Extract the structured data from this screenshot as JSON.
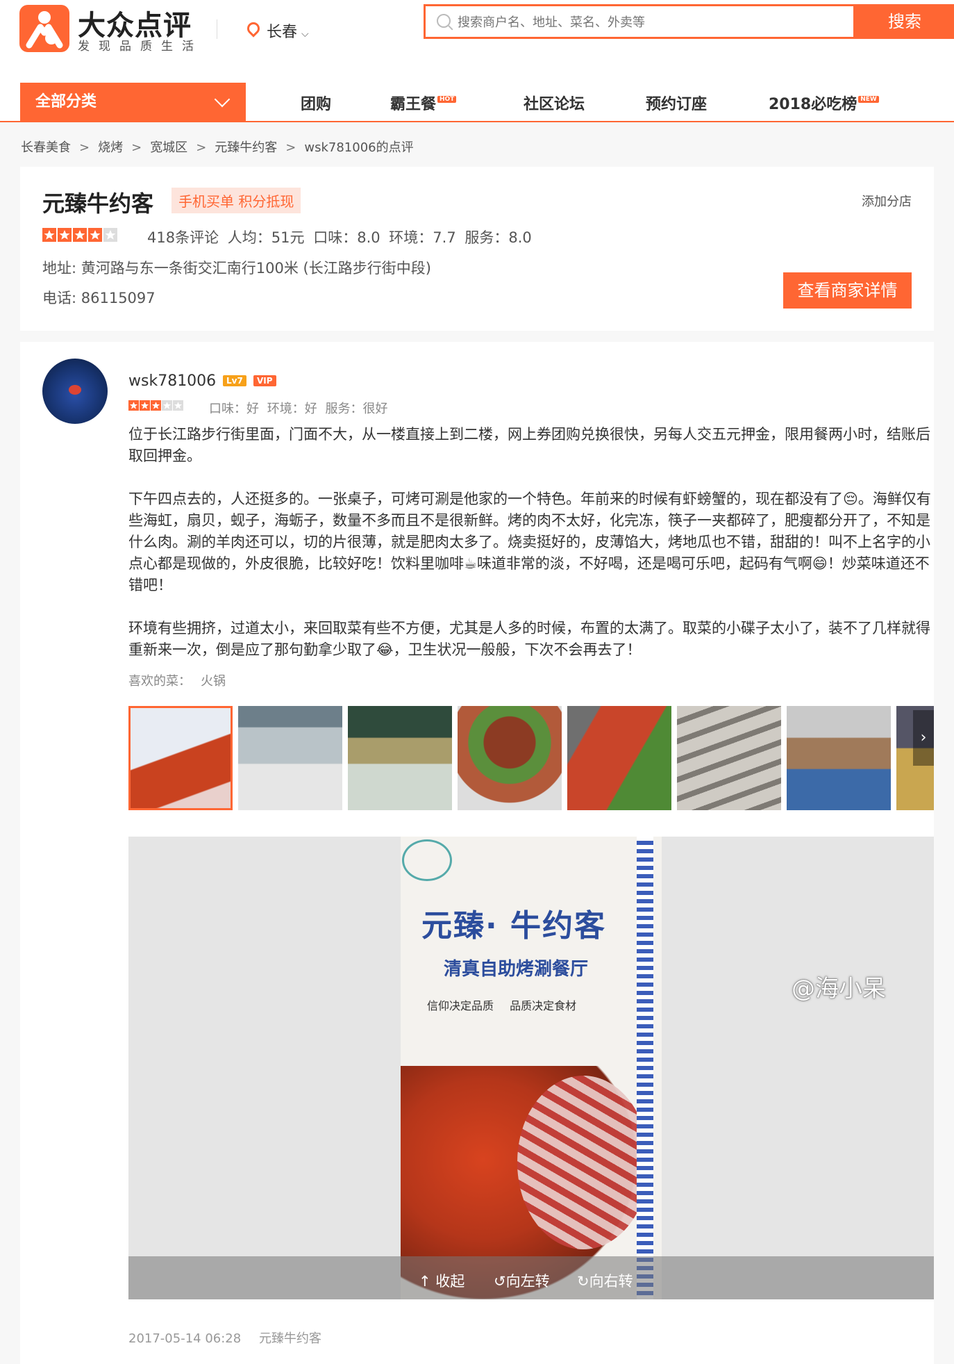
{
  "header": {
    "logo_title": "大众点评",
    "logo_slogan": "发现品质生活",
    "city": "长春",
    "search_placeholder": "搜索商户名、地址、菜名、外卖等",
    "search_button": "搜索",
    "accent_color": "#ff6633"
  },
  "nav": {
    "all_categories": "全部分类",
    "items": [
      {
        "label": "团购",
        "badge": ""
      },
      {
        "label": "霸王餐",
        "badge": "HOT"
      },
      {
        "label": "社区论坛",
        "badge": ""
      },
      {
        "label": "预约订座",
        "badge": ""
      },
      {
        "label": "2018必吃榜",
        "badge": "NEW"
      }
    ]
  },
  "breadcrumb": [
    "长春美食",
    "烧烤",
    "宽城区",
    "元臻牛约客",
    "wsk781006的点评"
  ],
  "breadcrumb_sep": ">",
  "shop": {
    "name": "元臻牛约客",
    "tag": "手机买单 积分抵现",
    "add_branch": "添加分店",
    "stars": 4,
    "reviews": "418条评论",
    "avg_price": "人均：51元",
    "taste": "口味：8.0",
    "env": "环境：7.7",
    "service": "服务：8.0",
    "address": "地址: 黄河路与东一条街交汇南行100米 (长江路步行街中段)",
    "phone": "电话: 86115097",
    "detail_button": "查看商家详情"
  },
  "review": {
    "user": "wsk781006",
    "level": "Lv7",
    "vip": "VIP",
    "stars": 3,
    "scores": "口味：好  环境：好  服务：很好",
    "paragraphs": [
      "位于长江路步行街里面，门面不大，从一楼直接上到二楼，网上券团购兑换很快，另每人交五元押金，限用餐两小时，结账后取回押金。",
      "下午四点去的，人还挺多的。一张桌子，可烤可涮是他家的一个特色。年前来的时候有虾螃蟹的，现在都没有了😔。海鲜仅有些海虹，扇贝，蚬子，海蛎子，数量不多而且不是很新鲜。烤的肉不太好，化完冻，筷子一夹都碎了，肥瘦都分开了，不知是什么肉。涮的羊肉还可以，切的片很薄，就是肥肉太多了。烧卖挺好的，皮薄馅大，烤地瓜也不错，甜甜的！叫不上名字的小点心都是现做的，外皮很脆，比较好吃！饮料里咖啡☕味道非常的淡，不好喝，还是喝可乐吧，起码有气啊😄！炒菜味道还不错吧！",
      "环境有些拥挤，过道太小，来回取菜有些不方便，尤其是人多的时候，布置的太满了。取菜的小碟子太小了，装不了几样就得重新来一次，倒是应了那句勤拿少取了😂，卫生状况一般般，下次不会再去了！"
    ],
    "liked_label": "喜欢的菜：",
    "liked_dish": "火锅",
    "photo_actions": [
      "收起",
      "向左转",
      "向右转"
    ],
    "poster_title": "元臻· 牛约客",
    "poster_subtitle": "清真自助烤涮餐厅",
    "poster_slogan": "信仰决定品质 品质决定食材",
    "date": "2017-05-14 06:28",
    "shop_ref": "元臻牛约客",
    "watermark": "@海小呆"
  }
}
